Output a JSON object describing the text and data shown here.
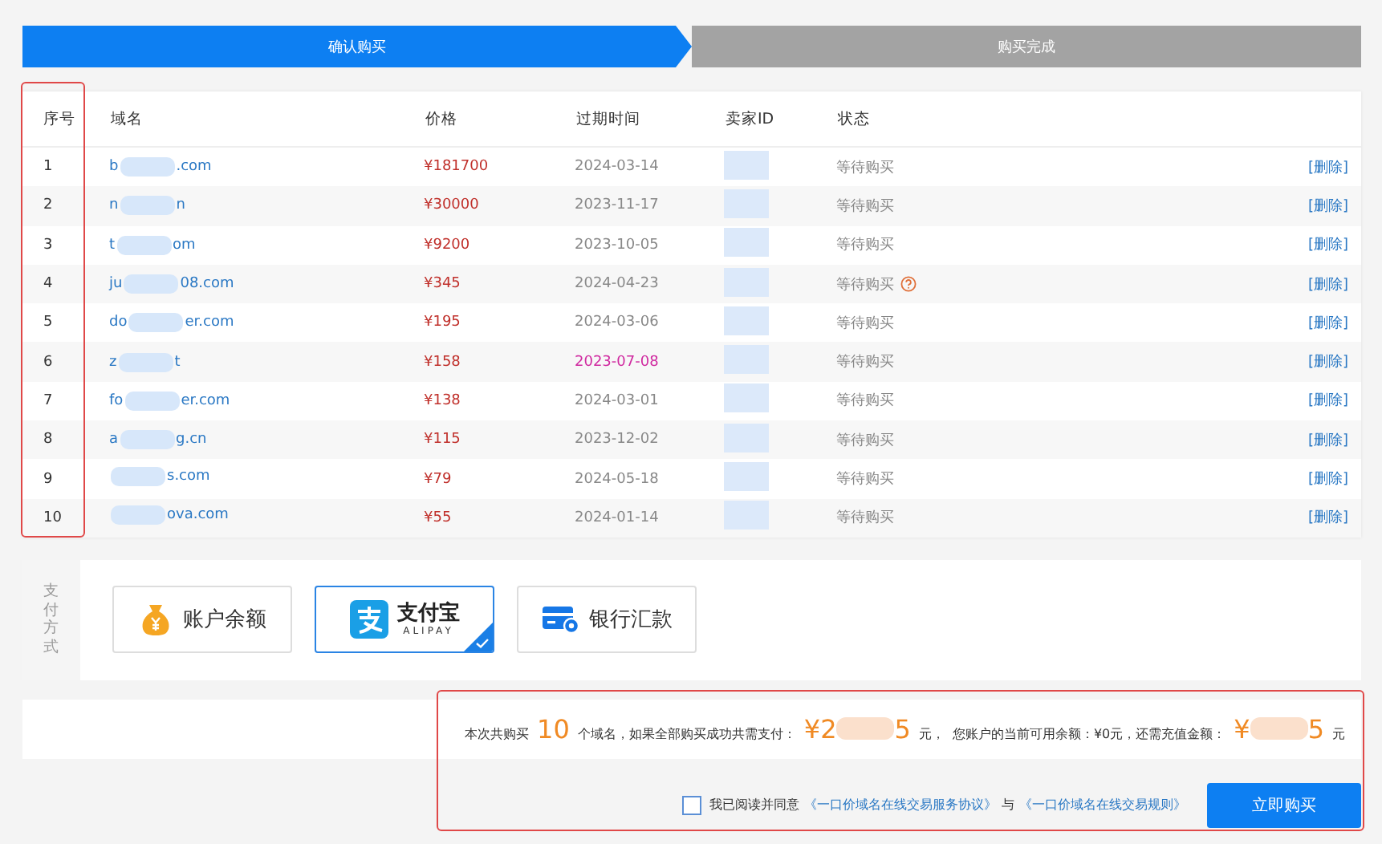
{
  "steps": [
    {
      "label": "确认购买",
      "selected": true
    },
    {
      "label": "购买完成",
      "selected": false
    }
  ],
  "table": {
    "columns": [
      "序号",
      "域名",
      "价格",
      "过期时间",
      "卖家ID",
      "状态"
    ],
    "rows": [
      {
        "index": "1",
        "domain_start": "b",
        "domain_end": ".com",
        "price": "¥181700",
        "expiry": "2024-03-14",
        "expiry_warning": false,
        "status": "等待购买",
        "help": false,
        "action": "[删除]"
      },
      {
        "index": "2",
        "domain_start": "n",
        "domain_end": "n",
        "price": "¥30000",
        "expiry": "2023-11-17",
        "expiry_warning": false,
        "status": "等待购买",
        "help": false,
        "action": "[删除]"
      },
      {
        "index": "3",
        "domain_start": "t",
        "domain_end": "om",
        "price": "¥9200",
        "expiry": "2023-10-05",
        "expiry_warning": false,
        "status": "等待购买",
        "help": false,
        "action": "[删除]"
      },
      {
        "index": "4",
        "domain_start": "ju",
        "domain_end": "08.com",
        "price": "¥345",
        "expiry": "2024-04-23",
        "expiry_warning": false,
        "status": "等待购买",
        "help": true,
        "action": "[删除]"
      },
      {
        "index": "5",
        "domain_start": "do",
        "domain_end": "er.com",
        "price": "¥195",
        "expiry": "2024-03-06",
        "expiry_warning": false,
        "status": "等待购买",
        "help": false,
        "action": "[删除]"
      },
      {
        "index": "6",
        "domain_start": "z",
        "domain_end": "t",
        "price": "¥158",
        "expiry": "2023-07-08",
        "expiry_warning": true,
        "status": "等待购买",
        "help": false,
        "action": "[删除]"
      },
      {
        "index": "7",
        "domain_start": "fo",
        "domain_end": "er.com",
        "price": "¥138",
        "expiry": "2024-03-01",
        "expiry_warning": false,
        "status": "等待购买",
        "help": false,
        "action": "[删除]"
      },
      {
        "index": "8",
        "domain_start": "a",
        "domain_end": "g.cn",
        "price": "¥115",
        "expiry": "2023-12-02",
        "expiry_warning": false,
        "status": "等待购买",
        "help": false,
        "action": "[删除]"
      },
      {
        "index": "9",
        "domain_end": "s.com",
        "price": "¥79",
        "expiry": "2024-05-18",
        "expiry_warning": false,
        "status": "等待购买",
        "help": false,
        "action": "[删除]"
      },
      {
        "index": "10",
        "domain_end": "ova.com",
        "price": "¥55",
        "expiry": "2024-01-14",
        "expiry_warning": false,
        "status": "等待购买",
        "help": false,
        "action": "[删除]"
      }
    ]
  },
  "payment": {
    "label": "支付方式",
    "methods": [
      {
        "kind": "balance",
        "label": "账户余额",
        "selected": false
      },
      {
        "kind": "alipay",
        "label": "支付宝",
        "sublabel": "ALIPAY",
        "selected": true
      },
      {
        "kind": "bank",
        "label": "银行汇款",
        "selected": false
      }
    ]
  },
  "summary": {
    "text_1": "本次共购买",
    "count": "10",
    "text_2": "个域名，如果全部购买成功共需支付：",
    "total_start": "¥2",
    "total_end": "5",
    "text_3": "元，",
    "text_4": "您账户的当前可用余额：¥0元，还需充值金额：",
    "due_start": "¥",
    "due_end": "5",
    "text_5": "元"
  },
  "agreement": {
    "checked": false,
    "text": "我已阅读并同意",
    "link_1": "《一口价域名在线交易服务协议》",
    "joiner": "与",
    "link_2": "《一口价域名在线交易规则》"
  },
  "buy_button": "立即购买"
}
